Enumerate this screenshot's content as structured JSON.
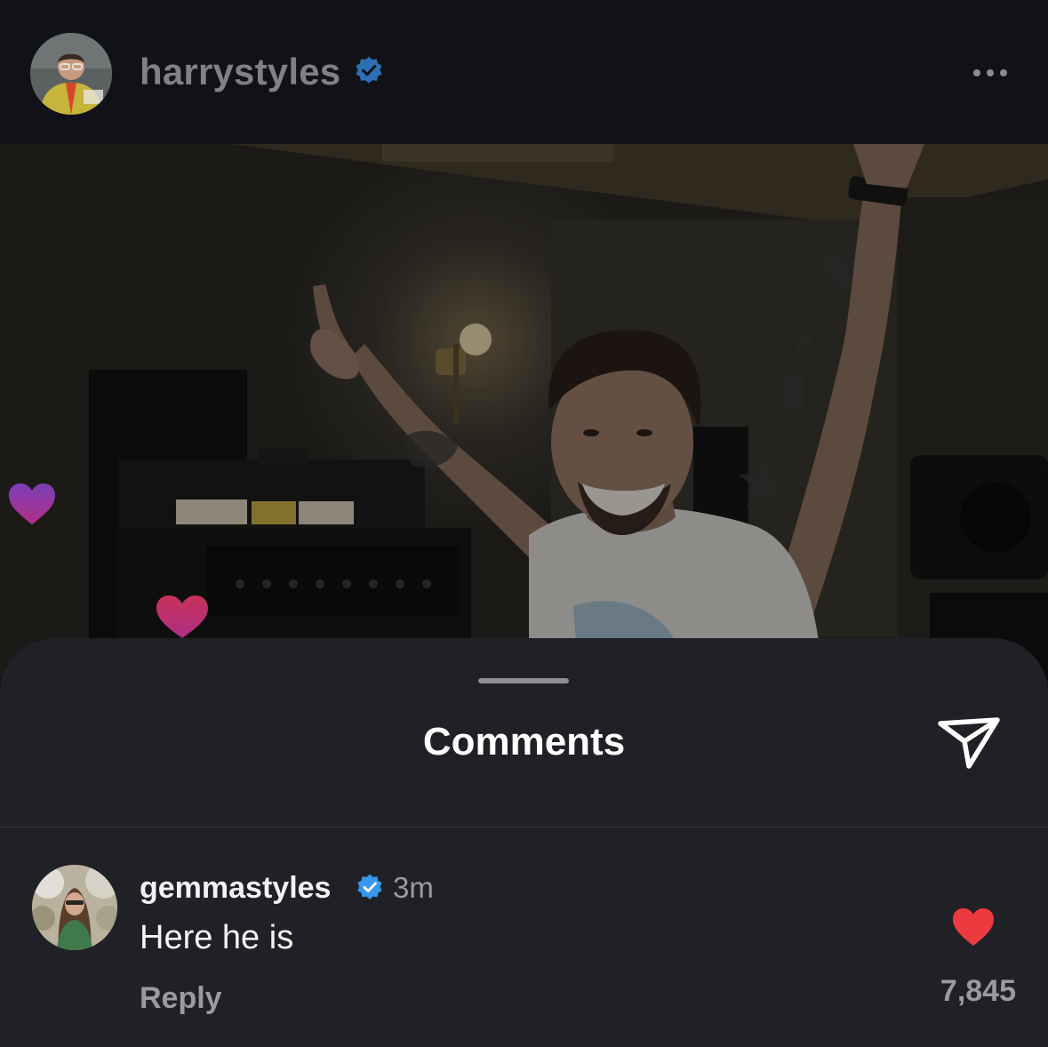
{
  "post": {
    "username": "harrystyles",
    "verified": true,
    "more_icon": "more-horizontal-icon"
  },
  "comments_sheet": {
    "title": "Comments",
    "share_icon": "paper-plane-icon"
  },
  "comment": {
    "username": "gemmastyles",
    "verified": true,
    "time": "3m",
    "text": "Here he is",
    "reply_label": "Reply",
    "like_count": "7,845",
    "liked": true,
    "like_color": "#ed3a3f"
  },
  "colors": {
    "verified_blue": "#3897f0",
    "sheet_bg": "#202126",
    "header_bg": "#101217"
  }
}
